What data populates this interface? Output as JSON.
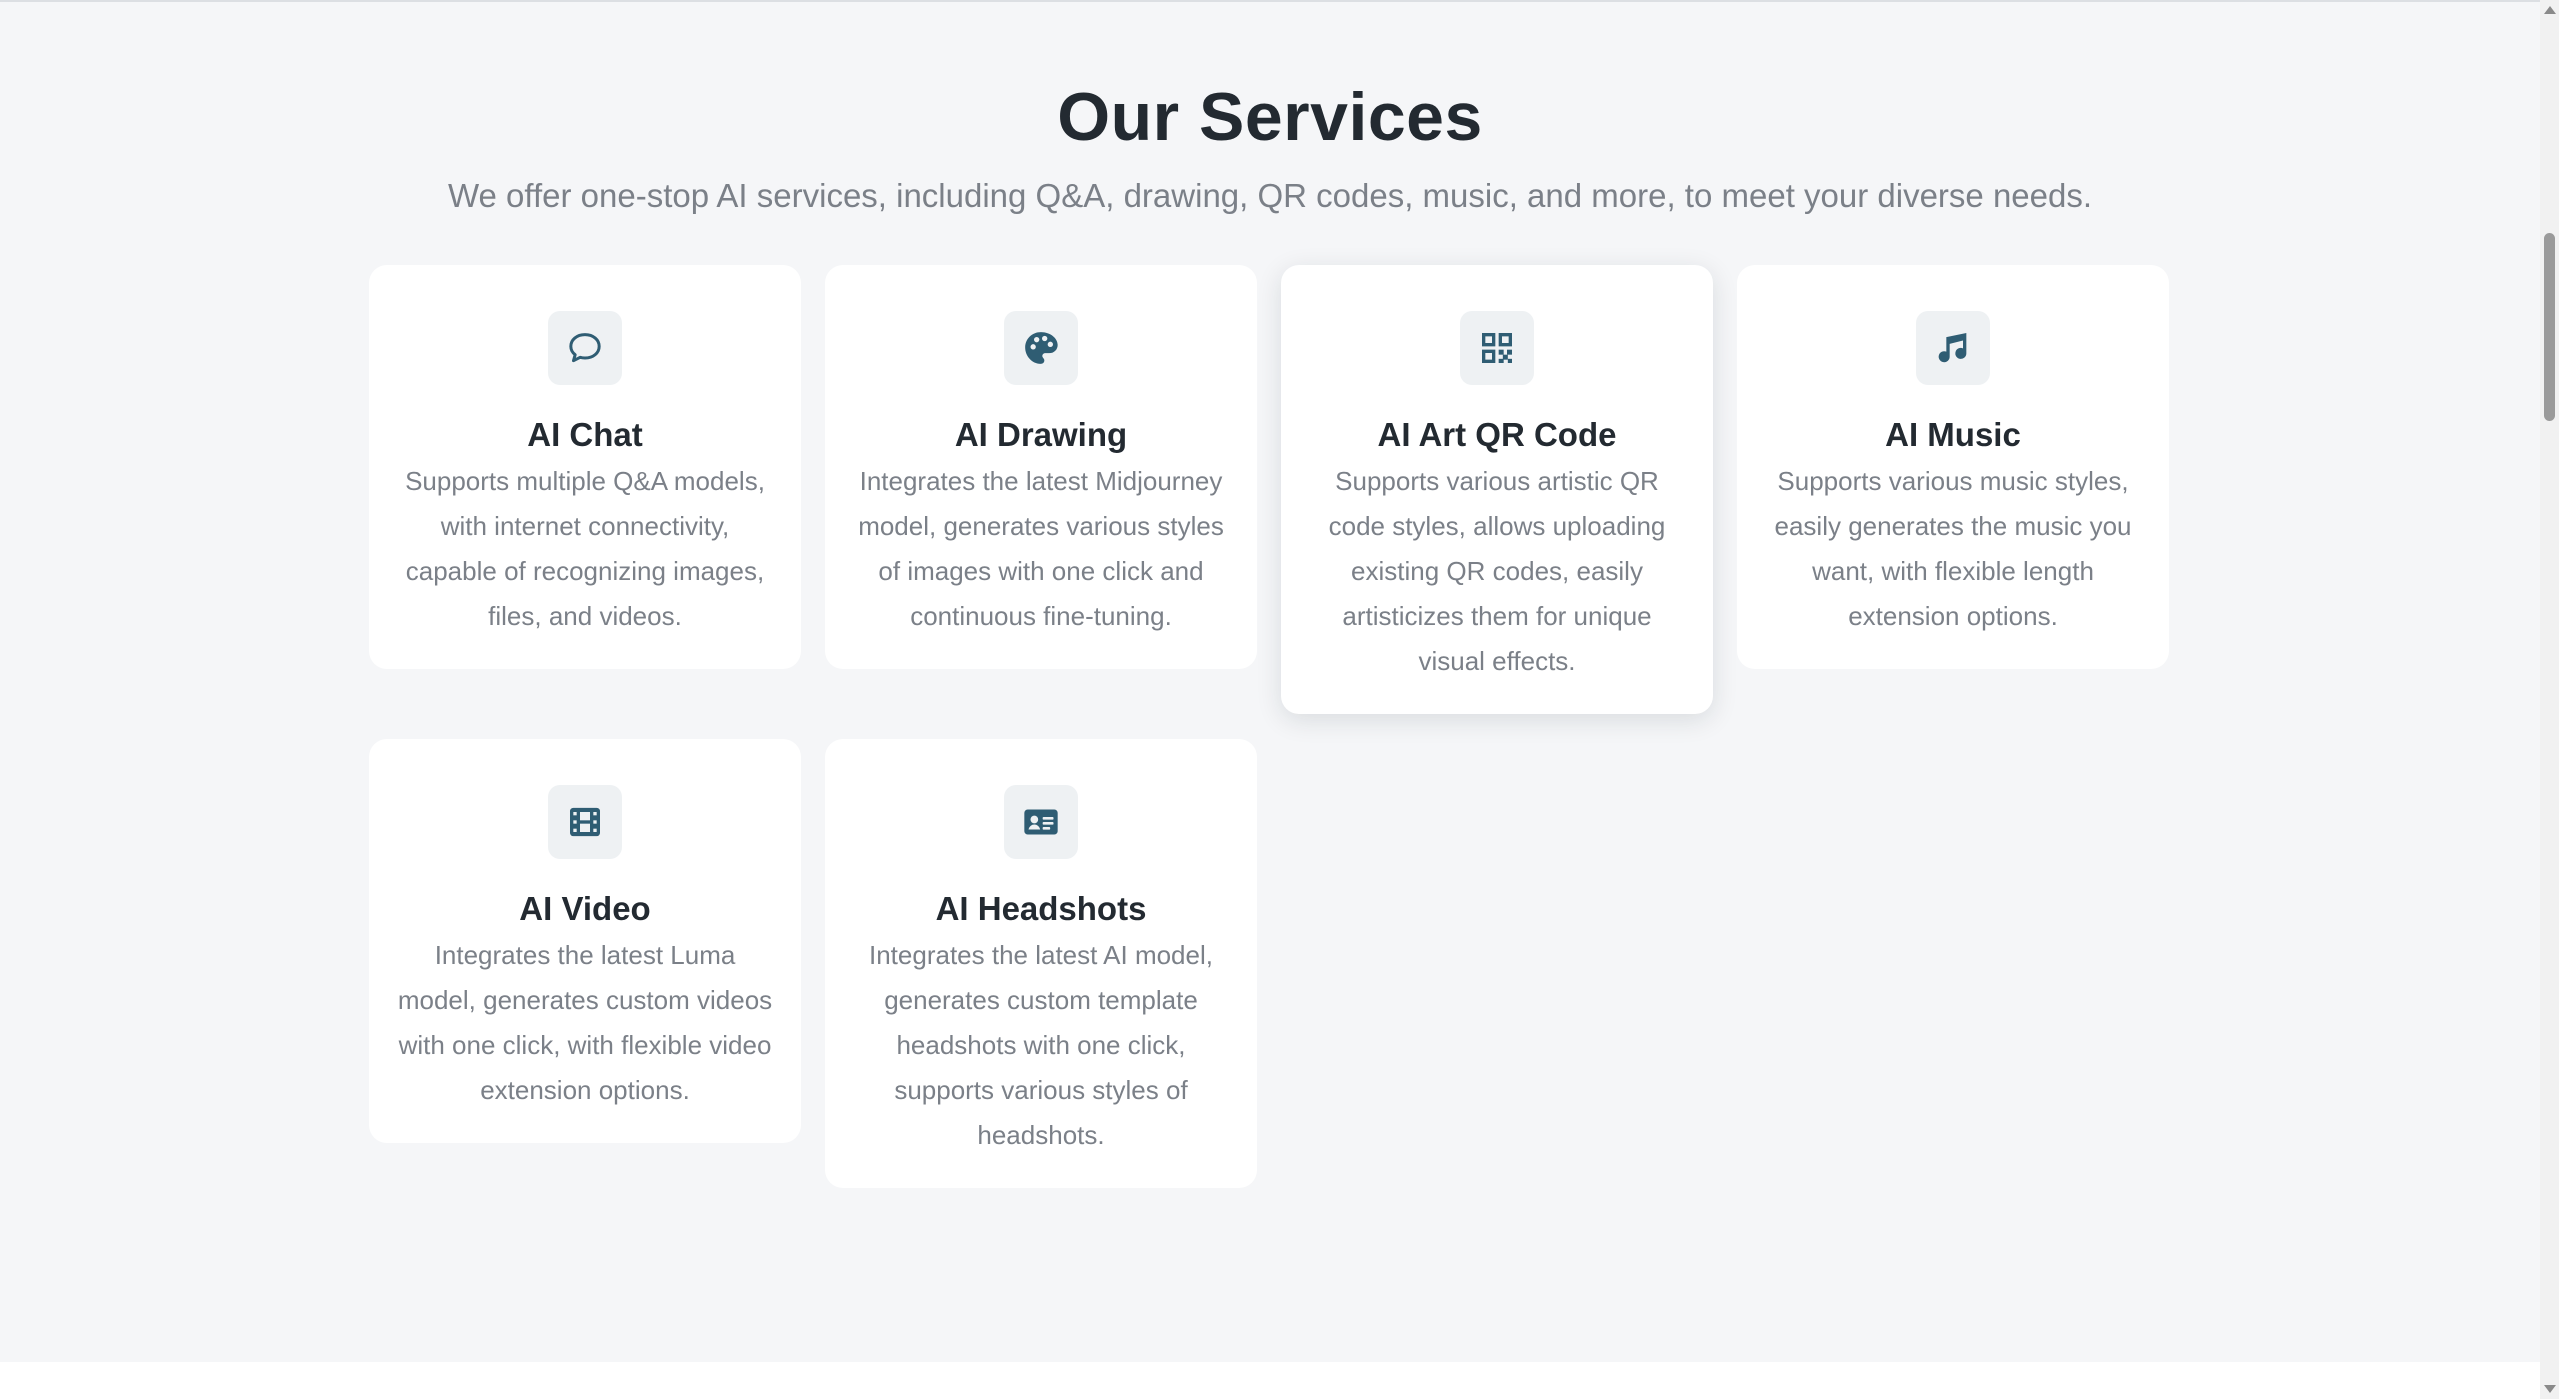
{
  "section": {
    "title": "Our Services",
    "subtitle": "We offer one-stop AI services, including Q&A, drawing, QR codes, music, and more, to meet your diverse needs."
  },
  "colors": {
    "icon": "#2f5d73",
    "title": "#232a31",
    "text": "#7b8088",
    "background": "#f5f6f8",
    "card": "#ffffff",
    "icon_bg": "#eef1f3"
  },
  "services": [
    {
      "icon": "chat-bubble-icon",
      "title": "AI Chat",
      "description": "Supports multiple Q&A models, with internet connectivity, capable of recognizing images, files, and videos."
    },
    {
      "icon": "palette-icon",
      "title": "AI Drawing",
      "description": "Integrates the latest Midjourney model, generates various styles of images with one click and continuous fine-tuning."
    },
    {
      "icon": "qr-code-icon",
      "title": "AI Art QR Code",
      "description": "Supports various artistic QR code styles, allows uploading existing QR codes, easily artisticizes them for unique visual effects."
    },
    {
      "icon": "music-note-icon",
      "title": "AI Music",
      "description": "Supports various music styles, easily generates the music you want, with flexible length extension options."
    },
    {
      "icon": "film-icon",
      "title": "AI Video",
      "description": "Integrates the latest Luma model, generates custom videos with one click, with flexible video extension options."
    },
    {
      "icon": "id-card-icon",
      "title": "AI Headshots",
      "description": "Integrates the latest AI model, generates custom template headshots with one click, supports various styles of headshots."
    }
  ]
}
